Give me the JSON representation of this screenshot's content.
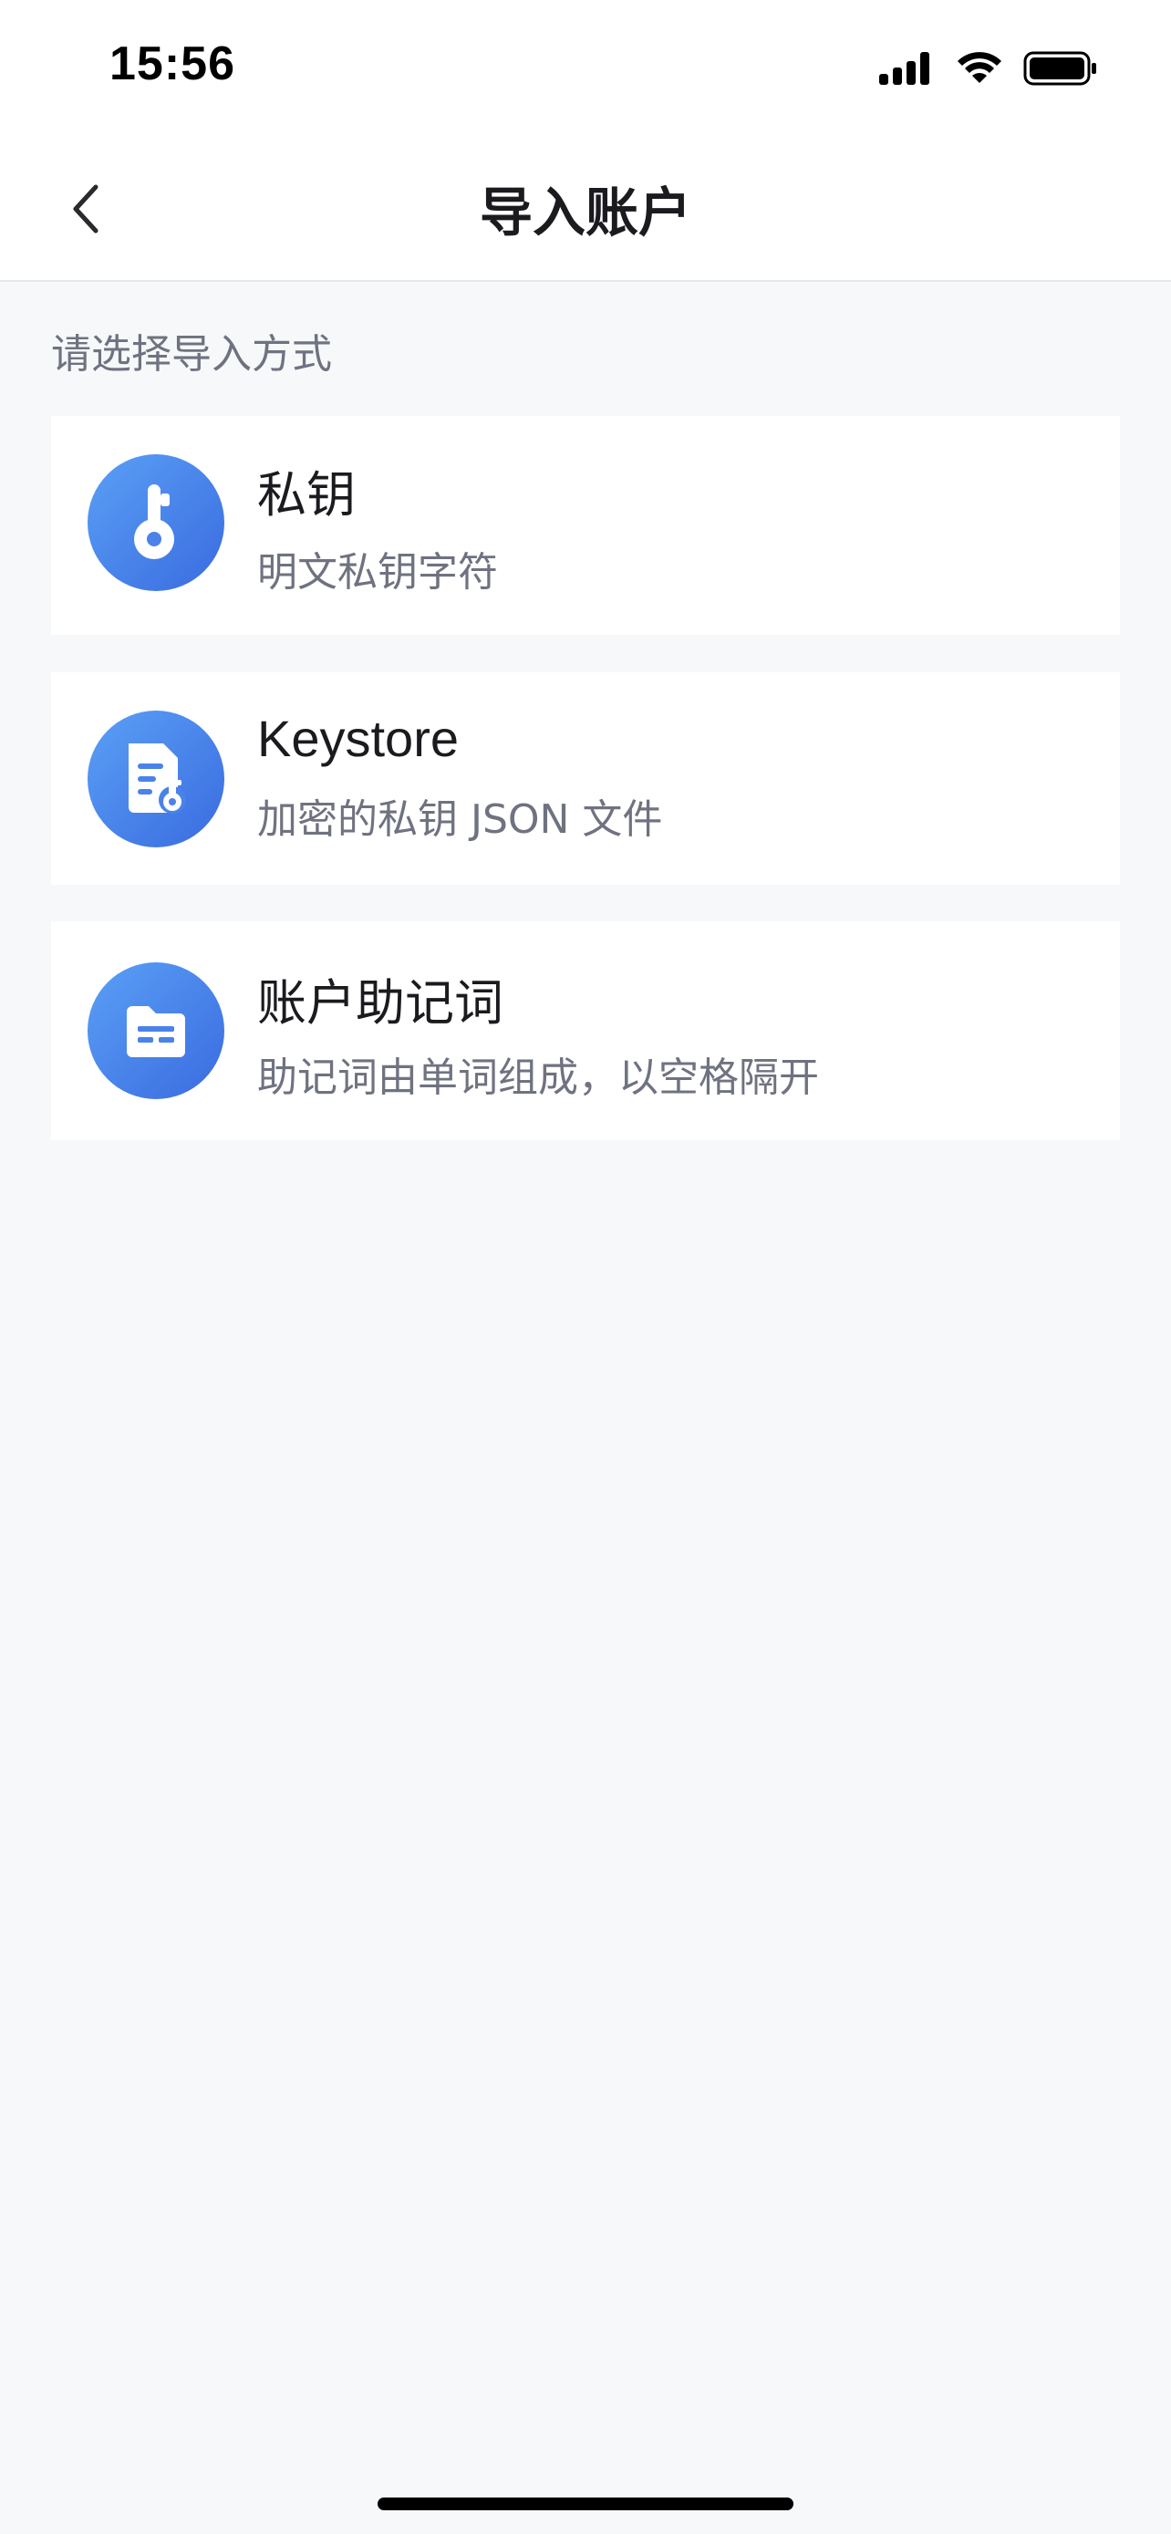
{
  "status_bar": {
    "time": "15:56",
    "icons": [
      "signal-icon",
      "wifi-icon",
      "battery-icon"
    ]
  },
  "nav": {
    "title": "导入账户",
    "back_icon": "chevron-left-icon"
  },
  "section": {
    "hint": "请选择导入方式"
  },
  "options": [
    {
      "title": "私钥",
      "description": "明文私钥字符",
      "icon": "key-icon"
    },
    {
      "title": "Keystore",
      "description": "加密的私钥 JSON 文件",
      "icon": "keystore-file-icon"
    },
    {
      "title": "账户助记词",
      "description": "助记词由单词组成，以空格隔开",
      "icon": "mnemonic-folder-icon"
    }
  ],
  "colors": {
    "icon_gradient_start": "#5aa0f5",
    "icon_gradient_end": "#3a6be0",
    "background": "#f7f8fa",
    "card": "#ffffff",
    "secondary_text": "#6f7280"
  }
}
